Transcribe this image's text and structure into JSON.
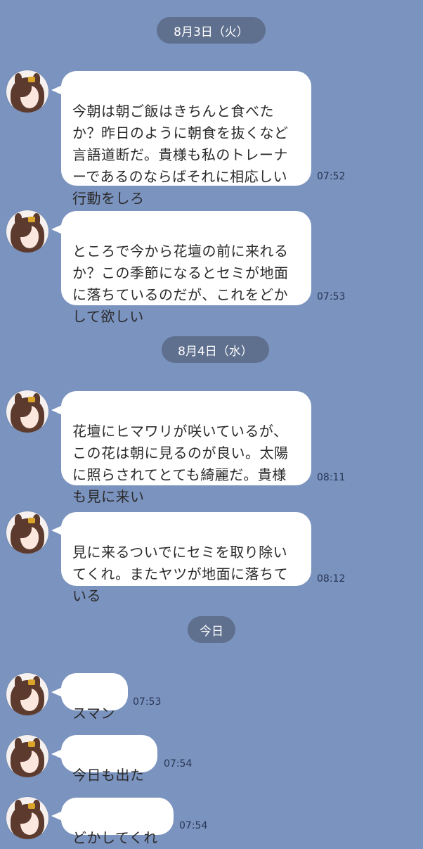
{
  "dates": [
    "8月3日（火）",
    "8月4日（水）",
    "今日"
  ],
  "messages": [
    {
      "text": "今朝は朝ご飯はきちんと食べたか？昨日のように朝食を抜くなど言語道断だ。貴様も私のトレーナーであるのならばそれに相応しい行動をしろ",
      "time": "07:52"
    },
    {
      "text": "ところで今から花壇の前に来れるか？この季節になるとセミが地面に落ちているのだが、これをどかして欲しい",
      "time": "07:53"
    },
    {
      "text": "花壇にヒマワリが咲いているが、この花は朝に見るのが良い。太陽に照らされてとても綺麗だ。貴様も見に来い",
      "time": "08:11"
    },
    {
      "text": "見に来るついでにセミを取り除いてくれ。またヤツが地面に落ちている",
      "time": "08:12"
    },
    {
      "text": "スマン",
      "time": "07:53"
    },
    {
      "text": "今日も出た",
      "time": "07:54"
    },
    {
      "text": "どかしてくれ",
      "time": "07:54"
    }
  ]
}
